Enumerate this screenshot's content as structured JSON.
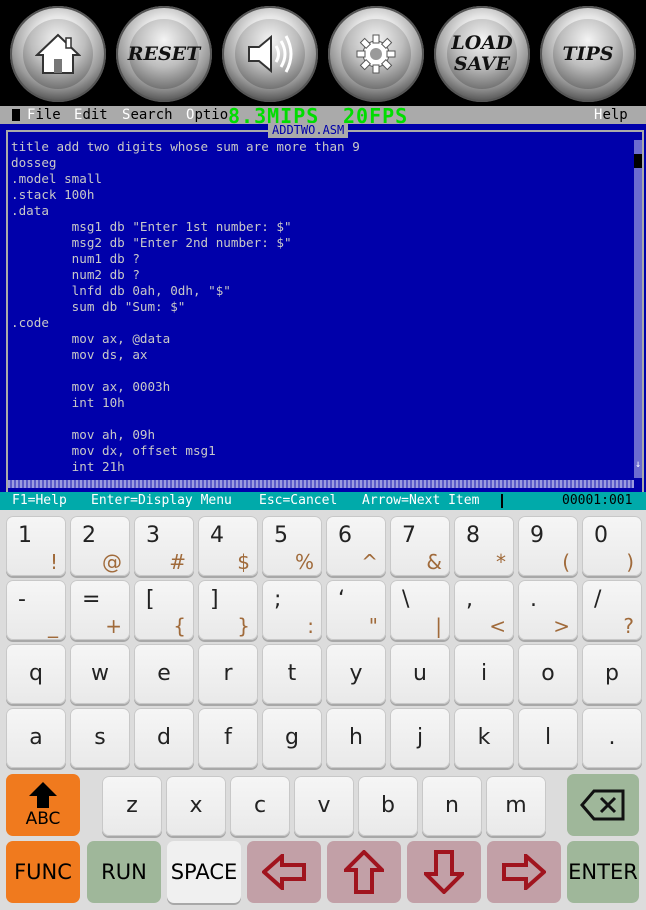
{
  "toolbar": {
    "buttons": [
      {
        "name": "home-button",
        "icon": "home-icon"
      },
      {
        "name": "reset-button",
        "label": "RESET"
      },
      {
        "name": "sound-button",
        "icon": "speaker-icon"
      },
      {
        "name": "settings-button",
        "icon": "gear-icon"
      },
      {
        "name": "load-save-button",
        "label_line1": "LOAD",
        "label_line2": "SAVE"
      },
      {
        "name": "tips-button",
        "label": "TIPS"
      }
    ]
  },
  "dos": {
    "menu": {
      "file": {
        "hot": "F",
        "rest": "ile"
      },
      "edit": {
        "hot": "E",
        "rest": "dit"
      },
      "search": {
        "hot": "S",
        "rest": "earch"
      },
      "options": {
        "hot": "O",
        "rest": "ptio"
      },
      "help": {
        "hot": "H",
        "rest": "elp"
      }
    },
    "overlay": {
      "mips": "8.3MIPS",
      "fps": "20FPS"
    },
    "file_title": "ADDTWO.ASM",
    "code_lines": [
      "title add two digits whose sum are more than 9",
      "dosseg",
      ".model small",
      ".stack 100h",
      ".data",
      "        msg1 db \"Enter 1st number: $\"",
      "        msg2 db \"Enter 2nd number: $\"",
      "        num1 db ?",
      "        num2 db ?",
      "        lnfd db 0ah, 0dh, \"$\"",
      "        sum db \"Sum: $\"",
      ".code",
      "        mov ax, @data",
      "        mov ds, ax",
      "",
      "        mov ax, 0003h",
      "        int 10h",
      "",
      "        mov ah, 09h",
      "        mov dx, offset msg1",
      "        int 21h"
    ],
    "status": {
      "help": "F1=Help",
      "enter": "Enter=Display Menu",
      "esc": "Esc=Cancel",
      "arrow": "Arrow=Next Item",
      "position": "00001:001"
    }
  },
  "keyboard": {
    "row1": [
      [
        "1",
        "!"
      ],
      [
        "2",
        "@"
      ],
      [
        "3",
        "#"
      ],
      [
        "4",
        "$"
      ],
      [
        "5",
        "%"
      ],
      [
        "6",
        "^"
      ],
      [
        "7",
        "&"
      ],
      [
        "8",
        "*"
      ],
      [
        "9",
        "("
      ],
      [
        "0",
        ")"
      ]
    ],
    "row2": [
      [
        "-",
        "_"
      ],
      [
        "=",
        "+"
      ],
      [
        "[",
        "{"
      ],
      [
        "]",
        "}"
      ],
      [
        ";",
        ":"
      ],
      [
        "‘",
        "\""
      ],
      [
        "\\",
        "|"
      ],
      [
        ",",
        "<"
      ],
      [
        ".",
        ">"
      ],
      [
        "/",
        "?"
      ]
    ],
    "row3": [
      "q",
      "w",
      "e",
      "r",
      "t",
      "y",
      "u",
      "i",
      "o",
      "p"
    ],
    "row4": [
      "a",
      "s",
      "d",
      "f",
      "g",
      "h",
      "j",
      "k",
      "l",
      "."
    ],
    "row5": [
      "z",
      "x",
      "c",
      "v",
      "b",
      "n",
      "m"
    ],
    "shift_label": "ABC",
    "func_label": "FUNC",
    "run_label": "RUN",
    "space_label": "SPACE",
    "enter_label": "ENTER",
    "colors": {
      "orange": "#f07a1e",
      "green": "#9fb79a",
      "rose": "#c2a0a7",
      "arrow_red": "#a0141e"
    }
  }
}
